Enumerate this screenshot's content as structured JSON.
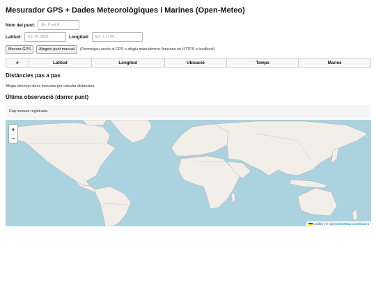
{
  "page": {
    "title": "Mesurador GPS + Dades Meteorològiques i Marines (Open-Meteo)"
  },
  "form": {
    "name_label": "Nom del punt:",
    "name_placeholder": "Ex: Punt A",
    "lat_label": "Latitud:",
    "lat_placeholder": "Ex: 41.3851",
    "lon_label": "Longitud:",
    "lon_placeholder": "Ex: 2.1734"
  },
  "actions": {
    "measure_gps": "Mesura GPS",
    "add_manual": "Afegeix punt manual",
    "hint": "(Permetgeu accés al GPS o afegiu manualment; funciona en HTTPS o localhost)"
  },
  "table": {
    "headers": [
      "#",
      "Latitud",
      "Longitud",
      "Ubicació",
      "Temps",
      "Marine"
    ]
  },
  "distances": {
    "title": "Distàncies pas a pas",
    "note": "Afegiu almenys dues mesures per calcular distàncies."
  },
  "observation": {
    "title": "Última observació (darrer punt)",
    "empty_text": "Cap mesura registrada."
  },
  "map": {
    "zoom_in": "+",
    "zoom_out": "−",
    "attribution_link": "Leaflet",
    "attribution_sep": " | © ",
    "attribution_osm": "OpenStreetMap contributors",
    "colors": {
      "water": "#aad3df",
      "land": "#f2efe9",
      "border": "#b9a8b9"
    }
  }
}
